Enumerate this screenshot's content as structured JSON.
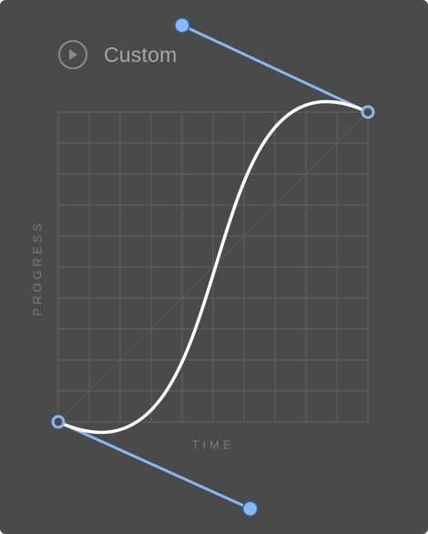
{
  "header": {
    "title": "Custom",
    "play_icon": "play-icon"
  },
  "axes": {
    "x_label": "TIME",
    "y_label": "PROGRESS"
  },
  "curve": {
    "type": "cubic-bezier",
    "control_point_1": [
      0.62,
      -0.28
    ],
    "control_point_2": [
      0.4,
      1.28
    ]
  },
  "colors": {
    "panel_background": "#4a4a4a",
    "grid": "#5e5e5e",
    "curve": "#ffffff",
    "handle": "#8ab8f5"
  }
}
